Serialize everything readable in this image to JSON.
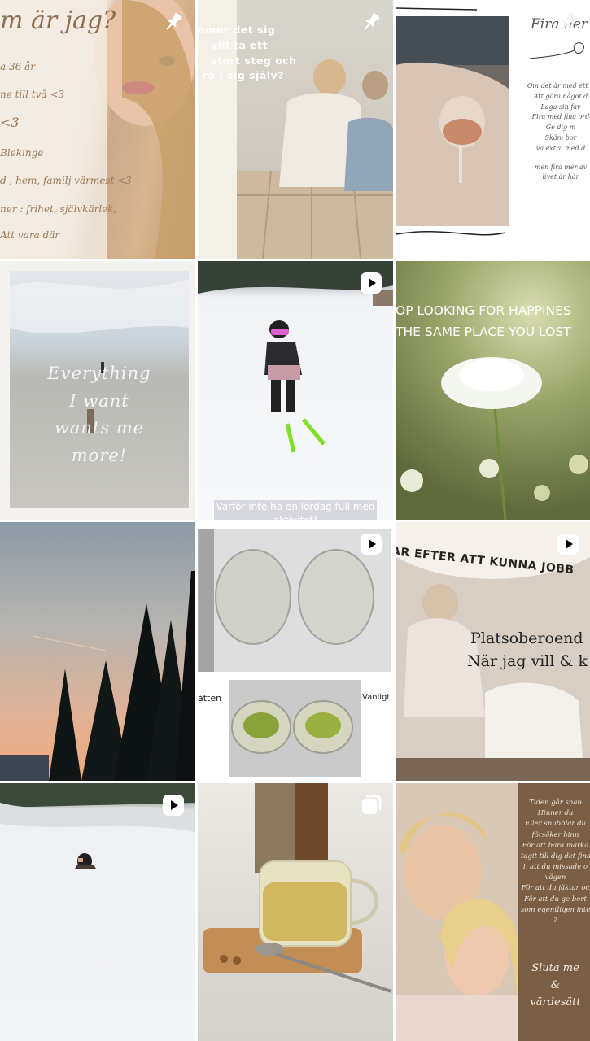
{
  "profile_grid": {
    "tiles": [
      {
        "id": "about-me",
        "badge": "pin-icon",
        "title": "m är jag?",
        "lines": [
          "a 36 år",
          "ne till två <3",
          "<3",
          "Blekinge",
          "d , hem, familj värmest <3",
          "ner : frihet, självkärlek,",
          "Att vara där"
        ]
      },
      {
        "id": "couple-dock",
        "badge": "pin-icon",
        "lines": [
          "nmer det sig",
          "vill ta ett",
          "stort steg och",
          "ra i sig själv?"
        ]
      },
      {
        "id": "wine-quote",
        "badge": "pin-icon",
        "title": "Fira ner",
        "lines": [
          "Om det är med ett g",
          "Att göra något d",
          "Laga sin fav",
          "Fira med fina ord",
          "Ge dig m",
          "Skäm bor",
          "va extra med d",
          "",
          "men fira mer av",
          "livet är här"
        ]
      },
      {
        "id": "beach-quote",
        "lines": [
          "Everything",
          "I want",
          "wants me",
          "more!"
        ]
      },
      {
        "id": "ski-kid",
        "badge": "play-icon",
        "caption": "Varför inte ha en lördag full med aktivitet!"
      },
      {
        "id": "flower-quote",
        "lines": [
          "OP LOOKING FOR HAPPINES",
          "THE SAME PLACE YOU LOST"
        ]
      },
      {
        "id": "sunset-trees"
      },
      {
        "id": "water-bowls",
        "badge": "play-icon",
        "left_label": "atten",
        "right_label": "Vanligt"
      },
      {
        "id": "work-freedom",
        "badge": "play-icon",
        "arc_text": "AR EFTER ATT KUNNA JOBB",
        "lines": [
          "Platsoberoend",
          "När jag vill & k"
        ]
      },
      {
        "id": "sledding",
        "badge": "play-icon"
      },
      {
        "id": "tea-cup",
        "badge": "carousel-icon"
      },
      {
        "id": "time-quote",
        "lines": [
          "Tiden går snab",
          "Hinner du",
          "Eller snubblar du",
          "försöker hinn",
          "För att bara märka",
          "tagit till dig det fina s",
          "i, att du missade o",
          "vägen",
          "För att du jäktar oc",
          "För att du ge bort",
          "som egentligen inte",
          "?"
        ],
        "footer": [
          "Sluta me",
          "&",
          "värdesätt"
        ]
      }
    ]
  },
  "colors": {
    "background": "#ffffff",
    "script_text": "#9a7a5a",
    "tea_panel": "#7a5f45"
  }
}
